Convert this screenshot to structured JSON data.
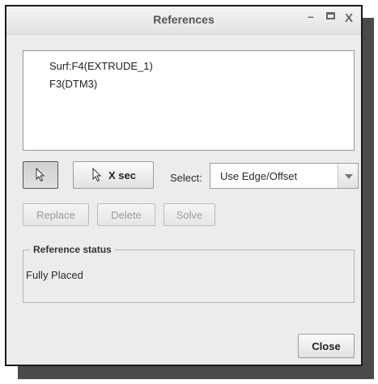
{
  "window": {
    "title": "References",
    "minimize_glyph": "–",
    "close_glyph": "X"
  },
  "references": {
    "items": [
      "Surf:F4(EXTRUDE_1)",
      "F3(DTM3)"
    ]
  },
  "toolbar": {
    "pick_icon": "arrow-cursor-icon",
    "xsec_label": "X sec",
    "select_label": "Select:",
    "select_value": "Use Edge/Offset"
  },
  "actions": {
    "replace_label": "Replace",
    "delete_label": "Delete",
    "solve_label": "Solve"
  },
  "status": {
    "legend": "Reference status",
    "value": "Fully Placed"
  },
  "footer": {
    "close_label": "Close"
  }
}
